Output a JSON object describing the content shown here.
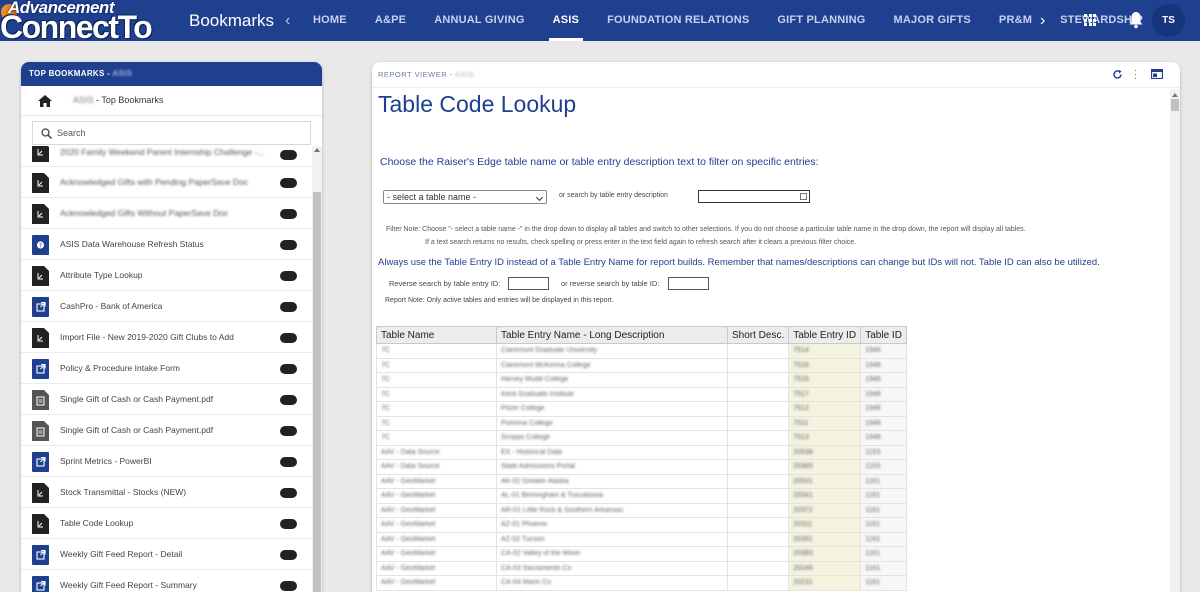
{
  "header": {
    "logo_line1": "Advancement",
    "logo_line2": "ConnectTo",
    "app_title": "Bookmarks",
    "nav_prev": "‹",
    "nav_next": "›",
    "tabs": [
      {
        "label": "HOME",
        "active": false
      },
      {
        "label": "A&PE",
        "active": false
      },
      {
        "label": "ANNUAL GIVING",
        "active": false
      },
      {
        "label": "ASIS",
        "active": true
      },
      {
        "label": "FOUNDATION RELATIONS",
        "active": false
      },
      {
        "label": "GIFT PLANNING",
        "active": false
      },
      {
        "label": "MAJOR GIFTS",
        "active": false
      },
      {
        "label": "PR&M",
        "active": false
      },
      {
        "label": "STEWARDSHIP",
        "active": false
      }
    ],
    "avatar_initials": "TS",
    "brand_color": "#1f3f8f"
  },
  "left_panel": {
    "title": "TOP BOOKMARKS - ",
    "title_suffix": "ASIS",
    "crumb_prefix": "ASIS",
    "crumb_label": " - Top Bookmarks",
    "search_placeholder": "Search",
    "items": [
      {
        "label": "2020 Family Weekend Parent Internship Challenge -...",
        "icon": "file-dark",
        "blurred": true
      },
      {
        "label": "Acknowledged Gifts with Pending PaperSave Doc",
        "icon": "file-dark",
        "blurred": true
      },
      {
        "label": "Acknowledged Gifts Without PaperSave Doc",
        "icon": "file-dark",
        "blurred": true
      },
      {
        "label": "ASIS Data Warehouse Refresh Status",
        "icon": "file-blue-help",
        "blurred": false
      },
      {
        "label": "Attribute Type Lookup",
        "icon": "file-dark",
        "blurred": false
      },
      {
        "label": "CashPro - Bank of America",
        "icon": "file-blue-link",
        "blurred": false
      },
      {
        "label": "Import File - New 2019-2020 Gift Clubs to Add",
        "icon": "file-dark",
        "blurred": false
      },
      {
        "label": "Policy & Procedure Intake Form",
        "icon": "file-blue-link",
        "blurred": false
      },
      {
        "label": "Single Gift of Cash or Cash Payment.pdf",
        "icon": "file-pdf",
        "blurred": false
      },
      {
        "label": "Single Gift of Cash or Cash Payment.pdf",
        "icon": "file-pdf",
        "blurred": false
      },
      {
        "label": "Sprint Metrics - PowerBI",
        "icon": "file-blue-link",
        "blurred": false
      },
      {
        "label": "Stock Transmittal - Stocks (NEW)",
        "icon": "file-dark",
        "blurred": false
      },
      {
        "label": "Table Code Lookup",
        "icon": "file-dark",
        "blurred": false
      },
      {
        "label": "Weekly Gift Feed Report - Detail",
        "icon": "file-blue-link",
        "blurred": false
      },
      {
        "label": "Weekly Gift Feed Report - Summary",
        "icon": "file-blue-link",
        "blurred": false
      }
    ]
  },
  "report": {
    "viewer_label": "REPORT VIEWER - ",
    "viewer_suffix": "ASIS",
    "title": "Table Code Lookup",
    "choose_text": "Choose the Raiser's Edge table name or table entry description text to filter on specific entries:",
    "select_value": "- select a table name -",
    "or_search_label": "or search by table entry description",
    "filter_note_1": "Filter Note: Choose \"- select a table name -\" in the drop down to display all tables and switch to other selections. If you do not choose a particular table name in the drop down, the report will display all tables.",
    "filter_note_2": "If a text search returns no results, check spelling or press enter in the text field again to refresh search after it clears a previous filter choice.",
    "always_text": "Always use the Table Entry ID instead of a Table Entry Name for report builds. Remember that names/descriptions can change but IDs will not. Table ID can also be utilized.",
    "reverse_entry_label": "Reverse search by table entry ID:",
    "reverse_table_label": "or reverse search by table ID:",
    "report_note": "Report Note: Only active tables and entries will be displayed in this report.",
    "columns": [
      "Table Name",
      "Table Entry Name - Long Description",
      "Short Desc.",
      "Table Entry ID",
      "Table ID"
    ],
    "rows": [
      [
        "7C",
        "Claremont Graduate University",
        "",
        "7514",
        "1946"
      ],
      [
        "7C",
        "Claremont McKenna College",
        "",
        "7516",
        "1946"
      ],
      [
        "7C",
        "Harvey Mudd College",
        "",
        "7515",
        "1946"
      ],
      [
        "7C",
        "Keck Graduate Institute",
        "",
        "7517",
        "1946"
      ],
      [
        "7C",
        "Pitzer College",
        "",
        "7512",
        "1946"
      ],
      [
        "7C",
        "Pomona College",
        "",
        "7511",
        "1946"
      ],
      [
        "7C",
        "Scripps College",
        "",
        "7513",
        "1946"
      ],
      [
        "AAV - Data Source",
        "EX - Historical Data",
        "",
        "20538",
        "1153"
      ],
      [
        "AAV - Data Source",
        "State Admissions Portal",
        "",
        "20365",
        "1153"
      ],
      [
        "AAV - GeoMarket",
        "AK-02 Greater Alaska",
        "",
        "20531",
        "1161"
      ],
      [
        "AAV - GeoMarket",
        "AL-01 Birmingham & Tuscaloosa",
        "",
        "20341",
        "1161"
      ],
      [
        "AAV - GeoMarket",
        "AR-01 Little Rock & Southern Arkansas",
        "",
        "20372",
        "1161"
      ],
      [
        "AAV - GeoMarket",
        "AZ-01 Phoenix",
        "",
        "20311",
        "1161"
      ],
      [
        "AAV - GeoMarket",
        "AZ-02 Tucson",
        "",
        "20391",
        "1161"
      ],
      [
        "AAV - GeoMarket",
        "CA-02 Valley of the Moon",
        "",
        "20383",
        "1161"
      ],
      [
        "AAV - GeoMarket",
        "CA-03 Sacramento Co",
        "",
        "20246",
        "1161"
      ],
      [
        "AAV - GeoMarket",
        "CA-04 Marin Co",
        "",
        "20231",
        "1161"
      ]
    ]
  }
}
